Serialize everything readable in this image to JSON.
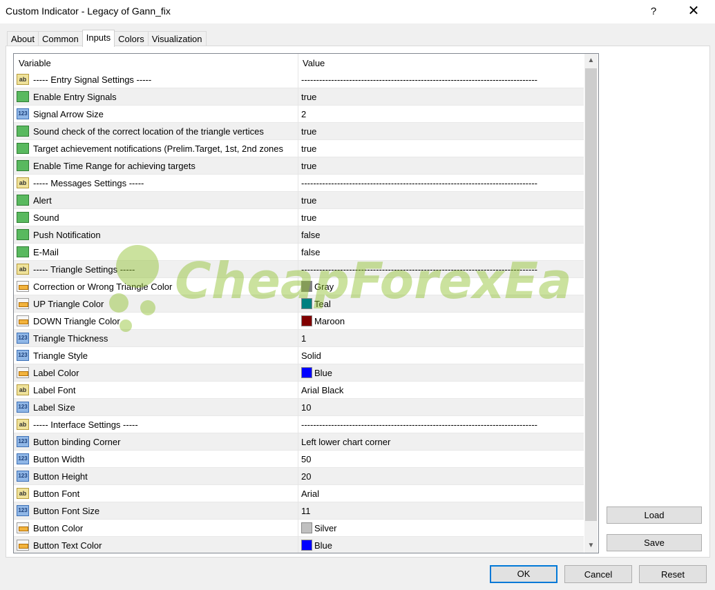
{
  "window": {
    "title": "Custom Indicator - Legacy of Gann_fix",
    "help_glyph": "?",
    "close_glyph": "✕"
  },
  "tabs": [
    {
      "label": "About",
      "active": false
    },
    {
      "label": "Common",
      "active": false
    },
    {
      "label": "Inputs",
      "active": true
    },
    {
      "label": "Colors",
      "active": false
    },
    {
      "label": "Visualization",
      "active": false
    }
  ],
  "grid": {
    "headers": {
      "variable": "Variable",
      "value": "Value"
    },
    "rows": [
      {
        "type": "ab",
        "name": "----- Entry Signal Settings -----",
        "value": "-------------------------------------------------------------------------------"
      },
      {
        "type": "bool",
        "name": "Enable Entry Signals",
        "value": "true"
      },
      {
        "type": "num",
        "name": "Signal Arrow Size",
        "value": "2"
      },
      {
        "type": "bool",
        "name": "Sound check of the correct location of the triangle vertices",
        "value": "true"
      },
      {
        "type": "bool",
        "name": "Target achievement notifications (Prelim.Target, 1st, 2nd zones",
        "value": "true"
      },
      {
        "type": "bool",
        "name": "Enable Time Range for achieving targets",
        "value": "true"
      },
      {
        "type": "ab",
        "name": "----- Messages Settings -----",
        "value": "-------------------------------------------------------------------------------"
      },
      {
        "type": "bool",
        "name": "Alert",
        "value": "true"
      },
      {
        "type": "bool",
        "name": "Sound",
        "value": "true"
      },
      {
        "type": "bool",
        "name": "Push Notification",
        "value": "false"
      },
      {
        "type": "bool",
        "name": "E-Mail",
        "value": "false"
      },
      {
        "type": "ab",
        "name": "----- Triangle Settings -----",
        "value": "-------------------------------------------------------------------------------"
      },
      {
        "type": "color",
        "name": "Correction or Wrong Triangle Color",
        "value": "Gray",
        "swatch": "#808080"
      },
      {
        "type": "color",
        "name": "UP Triangle Color",
        "value": "Teal",
        "swatch": "#008080"
      },
      {
        "type": "color",
        "name": "DOWN Triangle Color",
        "value": "Maroon",
        "swatch": "#800000"
      },
      {
        "type": "num",
        "name": "Triangle Thickness",
        "value": "1"
      },
      {
        "type": "num",
        "name": "Triangle Style",
        "value": "Solid"
      },
      {
        "type": "color",
        "name": "Label Color",
        "value": "Blue",
        "swatch": "#0000ff"
      },
      {
        "type": "ab",
        "name": "Label Font",
        "value": "Arial Black"
      },
      {
        "type": "num",
        "name": "Label Size",
        "value": "10"
      },
      {
        "type": "ab",
        "name": "----- Interface Settings -----",
        "value": "-------------------------------------------------------------------------------"
      },
      {
        "type": "num",
        "name": "Button binding Corner",
        "value": "Left lower chart corner"
      },
      {
        "type": "num",
        "name": "Button Width",
        "value": "50"
      },
      {
        "type": "num",
        "name": "Button Height",
        "value": "20"
      },
      {
        "type": "ab",
        "name": "Button Font",
        "value": "Arial"
      },
      {
        "type": "num",
        "name": "Button Font Size",
        "value": "11"
      },
      {
        "type": "color",
        "name": "Button Color",
        "value": "Silver",
        "swatch": "#c0c0c0"
      },
      {
        "type": "color",
        "name": "Button Text Color",
        "value": "Blue",
        "swatch": "#0000ff"
      }
    ]
  },
  "side_buttons": {
    "load": "Load",
    "save": "Save"
  },
  "footer_buttons": {
    "ok": "OK",
    "cancel": "Cancel",
    "reset": "Reset"
  },
  "watermark": {
    "text": "CheapForexEa"
  },
  "scrollbar": {
    "up_glyph": "▲",
    "down_glyph": "▼"
  }
}
